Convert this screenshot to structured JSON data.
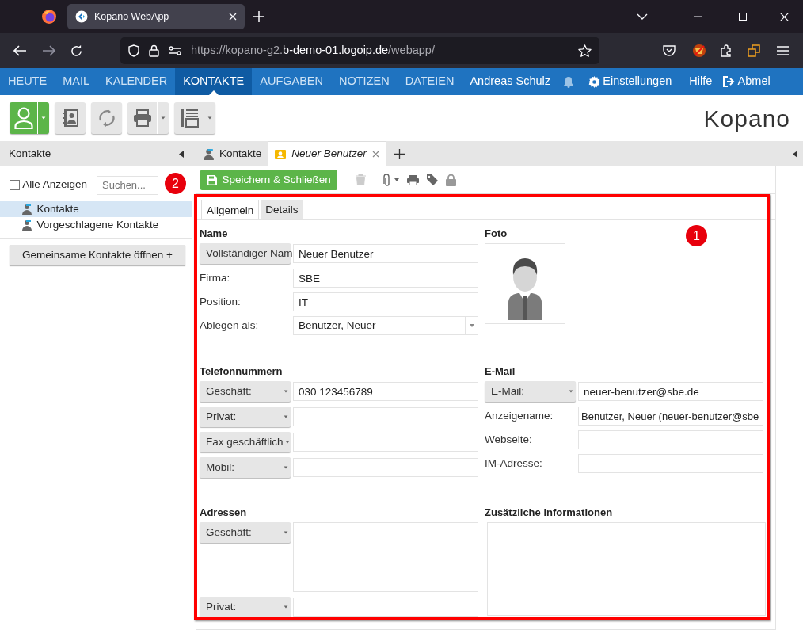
{
  "browser": {
    "tab_title": "Kopano WebApp",
    "url": {
      "prefix": "https://kopano-g2.",
      "host": "b-demo-01.logoip.de",
      "path": "/webapp/"
    }
  },
  "nav": {
    "items": [
      {
        "label": "HEUTE",
        "selected": false
      },
      {
        "label": "MAIL",
        "selected": false
      },
      {
        "label": "KALENDER",
        "selected": false
      },
      {
        "label": "KONTAKTE",
        "selected": true
      },
      {
        "label": "AUFGABEN",
        "selected": false
      },
      {
        "label": "NOTIZEN",
        "selected": false
      },
      {
        "label": "DATEIEN",
        "selected": false
      }
    ],
    "user": "Andreas Schulz",
    "settings": "Einstellungen",
    "help": "Hilfe",
    "logout": "Abmel"
  },
  "toolbar": {
    "logo": "Kopano"
  },
  "sidebar": {
    "title": "Kontakte",
    "show_all": {
      "label": "Alle Anzeigen",
      "checked": false
    },
    "search": {
      "placeholder": "Suchen..."
    },
    "items": [
      {
        "label": "Kontakte",
        "selected": true
      },
      {
        "label": "Vorgeschlagene Kontakte",
        "selected": false
      }
    ],
    "shared_button": "Gemeinsame Kontakte öffnen +"
  },
  "tabs": [
    {
      "label": "Kontakte",
      "kind": "folder",
      "selected": false
    },
    {
      "label": "Neuer Benutzer",
      "kind": "item",
      "selected": true
    }
  ],
  "editor": {
    "save_button": "Speichern & Schließen",
    "tabs": [
      {
        "label": "Allgemein",
        "selected": true
      },
      {
        "label": "Details",
        "selected": false
      }
    ],
    "name_section": {
      "title": "Name",
      "rows": [
        {
          "kind": "button",
          "label": "Vollständiger Nam",
          "value": "Neuer Benutzer"
        },
        {
          "kind": "label",
          "label": "Firma:",
          "value": "SBE"
        },
        {
          "kind": "label",
          "label": "Position:",
          "value": "IT"
        },
        {
          "kind": "combo",
          "label": "Ablegen als:",
          "value": "Benutzer, Neuer"
        }
      ]
    },
    "photo_section": {
      "title": "Foto"
    },
    "phone_section": {
      "title": "Telefonnummern",
      "rows": [
        {
          "kind": "dropdown",
          "label": "Geschäft:",
          "value": "030 123456789"
        },
        {
          "kind": "dropdown",
          "label": "Privat:"
        },
        {
          "kind": "dropdown",
          "label": "Fax geschäftlich"
        },
        {
          "kind": "dropdown",
          "label": "Mobil:"
        }
      ]
    },
    "email_section": {
      "title": "E-Mail",
      "rows": [
        {
          "kind": "dropdown",
          "label": "E-Mail:",
          "value": "neuer-benutzer@sbe.de"
        },
        {
          "kind": "label",
          "label": "Anzeigename:",
          "value": "Benutzer, Neuer (neuer-benutzer@sbe"
        },
        {
          "kind": "label",
          "label": "Webseite:"
        },
        {
          "kind": "label",
          "label": "IM-Adresse:"
        }
      ]
    },
    "address_section": {
      "title": "Adressen",
      "rows": [
        {
          "kind": "dropdown-area",
          "label": "Geschäft:"
        },
        {
          "kind": "dropdown",
          "label": "Privat:"
        }
      ]
    },
    "notes_section": {
      "title": "Zusätzliche Informationen"
    }
  },
  "annotations": [
    {
      "label": "1",
      "framed": true
    },
    {
      "label": "2",
      "framed": false
    }
  ]
}
